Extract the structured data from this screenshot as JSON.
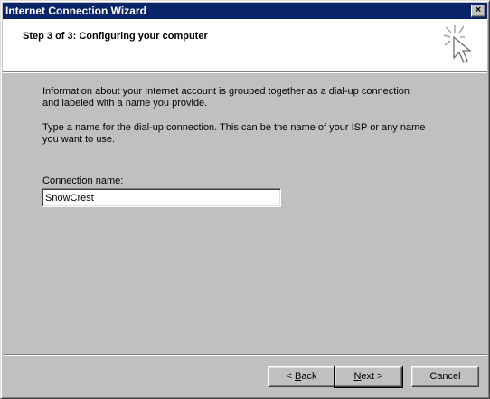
{
  "window": {
    "title": "Internet Connection Wizard",
    "close_glyph": "×"
  },
  "header": {
    "title": "Step 3 of 3: Configuring your computer",
    "icon": "cursor-click-icon"
  },
  "body": {
    "paragraph1_line1": "Information about your Internet account is grouped together as a dial-up connection",
    "paragraph1_line2": "and labeled with a name you provide.",
    "paragraph2_line1": "Type a name for the dial-up connection. This can be the name of your ISP or any name",
    "paragraph2_line2": "you want to use.",
    "field_label_accel": "C",
    "field_label_rest": "onnection name:",
    "field_value": "SnowCrest"
  },
  "buttons": {
    "back_prefix": "< ",
    "back_accel": "B",
    "back_rest": "ack",
    "next_accel": "N",
    "next_rest": "ext >",
    "cancel": "Cancel"
  }
}
